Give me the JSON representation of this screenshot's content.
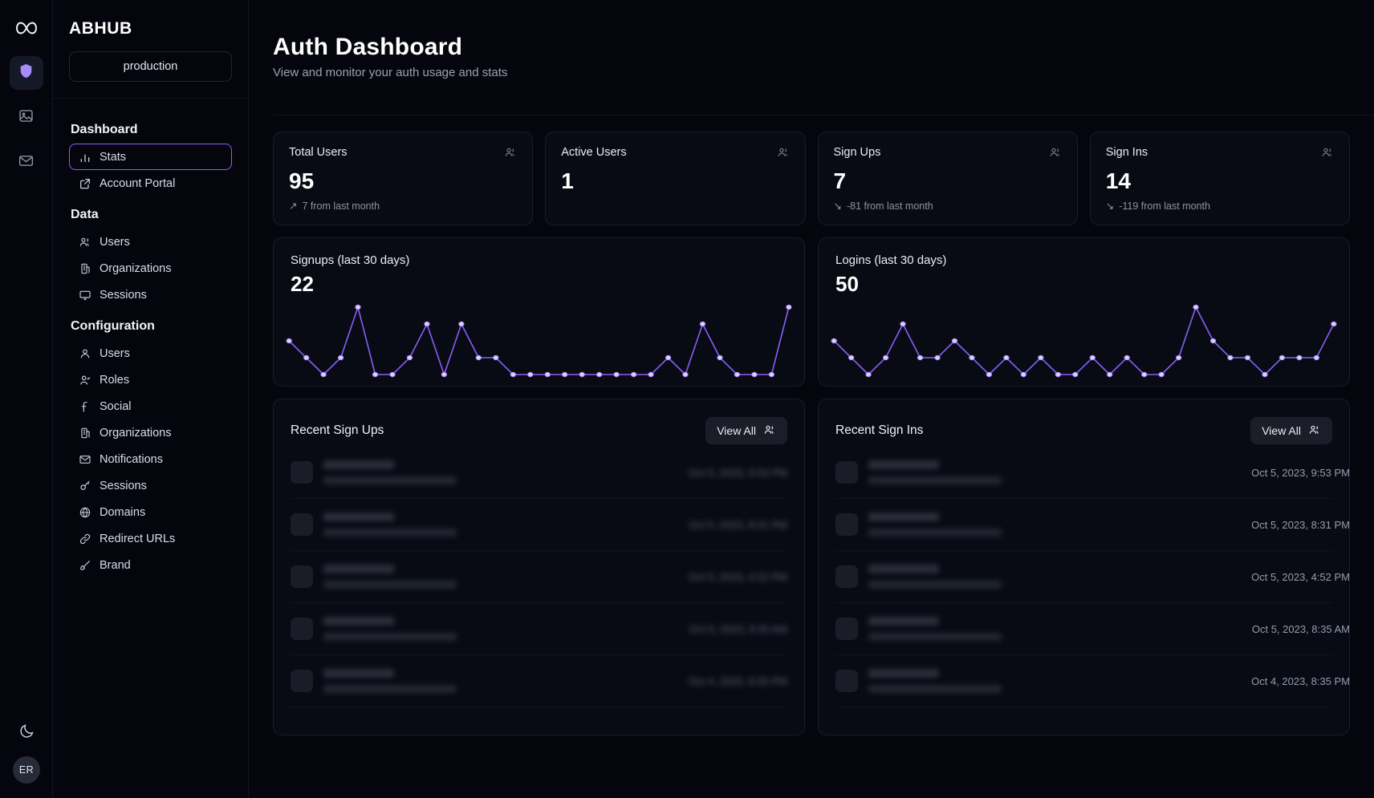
{
  "rail": {
    "logo_icon": "infinity-logo-icon",
    "items": [
      {
        "name": "shield-icon",
        "active": true
      },
      {
        "name": "image-icon",
        "active": false
      },
      {
        "name": "mail-icon",
        "active": false
      }
    ],
    "theme_toggle_icon": "moon-icon",
    "avatar_initials": "ER"
  },
  "sidebar": {
    "brand": "ABHUB",
    "environment": "production",
    "groups": [
      {
        "title": "Dashboard",
        "items": [
          {
            "label": "Stats",
            "icon": "bar-chart-icon",
            "active": true
          },
          {
            "label": "Account Portal",
            "icon": "external-link-icon",
            "active": false
          }
        ]
      },
      {
        "title": "Data",
        "items": [
          {
            "label": "Users",
            "icon": "users-icon",
            "active": false
          },
          {
            "label": "Organizations",
            "icon": "building-icon",
            "active": false
          },
          {
            "label": "Sessions",
            "icon": "monitor-icon",
            "active": false
          }
        ]
      },
      {
        "title": "Configuration",
        "items": [
          {
            "label": "Users",
            "icon": "user-icon",
            "active": false
          },
          {
            "label": "Roles",
            "icon": "user-check-icon",
            "active": false
          },
          {
            "label": "Social",
            "icon": "facebook-icon",
            "active": false
          },
          {
            "label": "Organizations",
            "icon": "building-icon",
            "active": false
          },
          {
            "label": "Notifications",
            "icon": "mail-icon",
            "active": false
          },
          {
            "label": "Sessions",
            "icon": "key-icon",
            "active": false
          },
          {
            "label": "Domains",
            "icon": "globe-icon",
            "active": false
          },
          {
            "label": "Redirect URLs",
            "icon": "link-icon",
            "active": false
          },
          {
            "label": "Brand",
            "icon": "brush-icon",
            "active": false
          }
        ]
      }
    ]
  },
  "header": {
    "title": "Auth Dashboard",
    "subtitle": "View and monitor your auth usage and stats"
  },
  "stats": [
    {
      "label": "Total Users",
      "value": "95",
      "delta": "7 from last month",
      "trend": "up",
      "icon": "users-icon"
    },
    {
      "label": "Active Users",
      "value": "1",
      "delta": "",
      "trend": "none",
      "icon": "users-icon"
    },
    {
      "label": "Sign Ups",
      "value": "7",
      "delta": "-81 from last month",
      "trend": "down",
      "icon": "users-icon"
    },
    {
      "label": "Sign Ins",
      "value": "14",
      "delta": "-119 from last month",
      "trend": "down",
      "icon": "users-icon"
    }
  ],
  "charts": [
    {
      "title": "Signups (last 30 days)",
      "value": "22"
    },
    {
      "title": "Logins (last 30 days)",
      "value": "50"
    }
  ],
  "chart_data": [
    {
      "type": "line",
      "title": "Signups (last 30 days)",
      "total": 22,
      "xlabel": "",
      "ylabel": "",
      "grid": false,
      "legend": "none",
      "ylim": [
        0,
        4
      ],
      "x": [
        1,
        2,
        3,
        4,
        5,
        6,
        7,
        8,
        9,
        10,
        11,
        12,
        13,
        14,
        15,
        16,
        17,
        18,
        19,
        20,
        21,
        22,
        23,
        24,
        25,
        26,
        27,
        28,
        29,
        30
      ],
      "values": [
        2,
        1,
        0,
        1,
        4,
        0,
        0,
        1,
        3,
        0,
        3,
        1,
        1,
        0,
        0,
        0,
        0,
        0,
        0,
        0,
        0,
        0,
        1,
        0,
        3,
        1,
        0,
        0,
        0,
        4
      ]
    },
    {
      "type": "line",
      "title": "Logins (last 30 days)",
      "total": 50,
      "xlabel": "",
      "ylabel": "",
      "grid": false,
      "legend": "none",
      "ylim": [
        0,
        4
      ],
      "x": [
        1,
        2,
        3,
        4,
        5,
        6,
        7,
        8,
        9,
        10,
        11,
        12,
        13,
        14,
        15,
        16,
        17,
        18,
        19,
        20,
        21,
        22,
        23,
        24,
        25,
        26,
        27,
        28,
        29,
        30
      ],
      "values": [
        2,
        1,
        0,
        1,
        3,
        1,
        1,
        2,
        1,
        0,
        1,
        0,
        1,
        0,
        0,
        1,
        0,
        1,
        0,
        0,
        1,
        4,
        2,
        1,
        1,
        0,
        1,
        1,
        1,
        3
      ]
    }
  ],
  "recent_signups": {
    "title": "Recent Sign Ups",
    "view_all_label": "View All",
    "view_all_icon": "users-icon",
    "rows": [
      {
        "name": "redacted",
        "email": "redacted",
        "date": "Oct 5, 2023, 9:53 PM",
        "blurred": true
      },
      {
        "name": "redacted",
        "email": "redacted",
        "date": "Oct 5, 2023, 8:31 PM",
        "blurred": true
      },
      {
        "name": "redacted",
        "email": "redacted",
        "date": "Oct 5, 2023, 4:52 PM",
        "blurred": true
      },
      {
        "name": "redacted",
        "email": "redacted",
        "date": "Oct 5, 2023, 8:35 AM",
        "blurred": true
      },
      {
        "name": "redacted",
        "email": "redacted",
        "date": "Oct 4, 2023, 8:35 PM",
        "blurred": true
      }
    ]
  },
  "recent_signins": {
    "title": "Recent Sign Ins",
    "view_all_label": "View All",
    "view_all_icon": "users-icon",
    "rows": [
      {
        "name": "redacted",
        "email": "redacted",
        "date": "Oct 5, 2023, 9:53 PM",
        "blurred": false
      },
      {
        "name": "redacted",
        "email": "redacted",
        "date": "Oct 5, 2023, 8:31 PM",
        "blurred": false
      },
      {
        "name": "redacted",
        "email": "redacted",
        "date": "Oct 5, 2023, 4:52 PM",
        "blurred": false
      },
      {
        "name": "redacted",
        "email": "redacted",
        "date": "Oct 5, 2023, 8:35 AM",
        "blurred": false
      },
      {
        "name": "redacted",
        "email": "redacted",
        "date": "Oct 4, 2023, 8:35 PM",
        "blurred": false
      }
    ]
  },
  "colors": {
    "background": "#05060d",
    "card": "#090b14",
    "border": "#1a1d27",
    "accent": "#8b5cf6",
    "accent_light": "#c4b5fd",
    "text": "#e8eaf2",
    "muted": "#9aa1b4"
  }
}
